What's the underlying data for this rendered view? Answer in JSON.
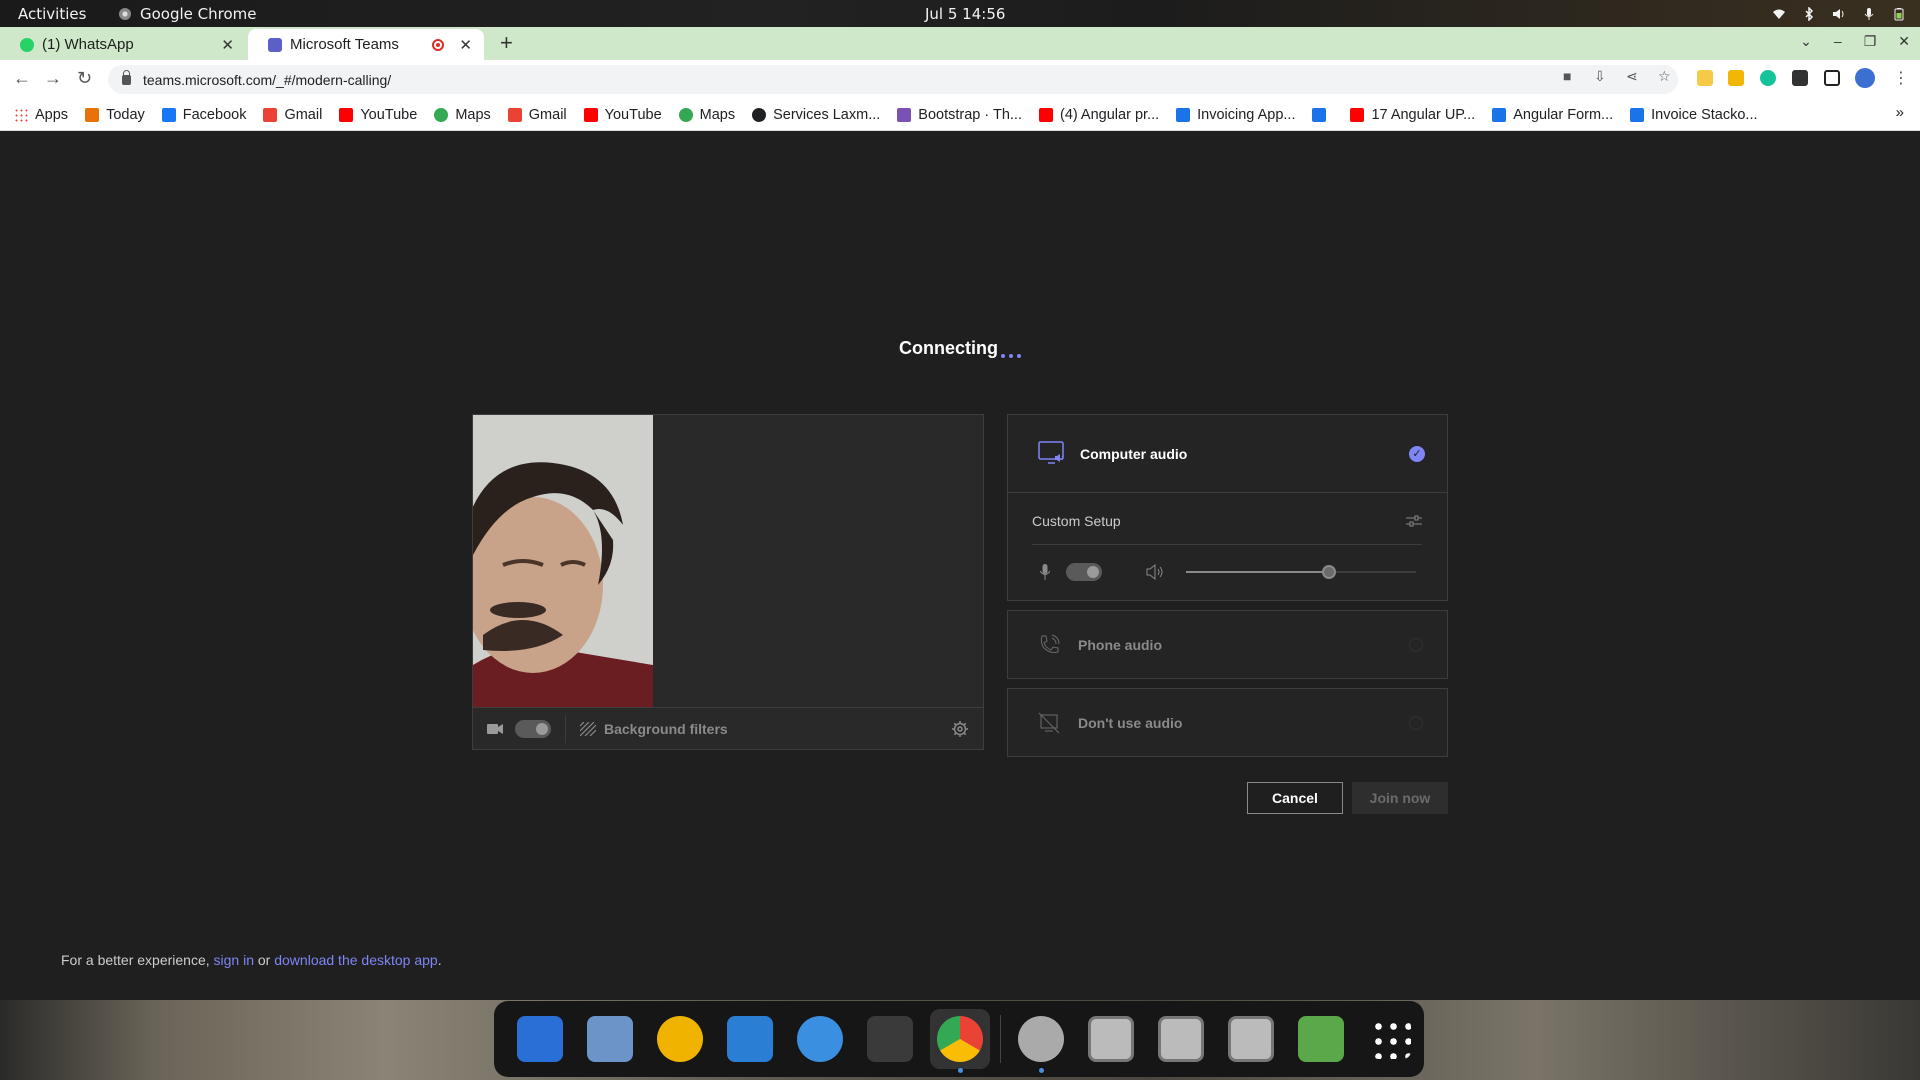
{
  "system": {
    "activities": "Activities",
    "app_name": "Google Chrome",
    "clock": "Jul 5  14:56"
  },
  "tabs": [
    {
      "label": "(1) WhatsApp",
      "favicon_color": "#25d366"
    },
    {
      "label": "Microsoft Teams",
      "favicon_color": "#5b5fc7",
      "recording": true
    }
  ],
  "address": {
    "url": "teams.microsoft.com/_#/modern-calling/"
  },
  "bookmarks": [
    {
      "label": "Apps",
      "icon": "apps-grid-icon",
      "color": "#4285f4"
    },
    {
      "label": "Today",
      "icon": "today-icon",
      "color": "#e8710a"
    },
    {
      "label": "Facebook",
      "icon": "facebook-icon",
      "color": "#1877f2"
    },
    {
      "label": "Gmail",
      "icon": "gmail-icon",
      "color": "#ea4335"
    },
    {
      "label": "YouTube",
      "icon": "youtube-icon",
      "color": "#ff0000"
    },
    {
      "label": "Maps",
      "icon": "maps-icon",
      "color": "#34a853"
    },
    {
      "label": "Gmail",
      "icon": "gmail-icon",
      "color": "#ea4335"
    },
    {
      "label": "YouTube",
      "icon": "youtube-icon",
      "color": "#ff0000"
    },
    {
      "label": "Maps",
      "icon": "maps-icon",
      "color": "#34a853"
    },
    {
      "label": "Services Laxm...",
      "icon": "globe-icon",
      "color": "#202124"
    },
    {
      "label": "Bootstrap · Th...",
      "icon": "bootstrap-icon",
      "color": "#7952b3"
    },
    {
      "label": "(4) Angular pr...",
      "icon": "youtube-icon",
      "color": "#ff0000"
    },
    {
      "label": "Invoicing App...",
      "icon": "bolt-icon",
      "color": "#1a73e8"
    },
    {
      "label": "",
      "icon": "bolt-icon",
      "color": "#1a73e8"
    },
    {
      "label": "17 Angular UP...",
      "icon": "youtube-icon",
      "color": "#ff0000"
    },
    {
      "label": "Angular Form...",
      "icon": "bolt-icon",
      "color": "#1a73e8"
    },
    {
      "label": "Invoice Stacko...",
      "icon": "bolt-icon",
      "color": "#1a73e8"
    }
  ],
  "bookmarks_overflow": "»",
  "teams": {
    "status": "Connecting",
    "video": {
      "background_filters": "Background filters"
    },
    "audio": {
      "computer_audio": "Computer audio",
      "custom_setup": "Custom Setup",
      "speaker_volume": 0.62,
      "phone_audio": "Phone audio",
      "dont_use_audio": "Don't use audio"
    },
    "buttons": {
      "cancel": "Cancel",
      "join": "Join now"
    },
    "footer": {
      "prefix": "For a better experience, ",
      "sign_in": "sign in",
      "or": " or ",
      "download": "download the desktop app",
      "suffix": "."
    },
    "accent_color": "#7f85f5"
  },
  "dock": [
    {
      "name": "thunderbird-icon",
      "color": "#2a6fd6"
    },
    {
      "name": "files-icon",
      "color": "#6d94c8"
    },
    {
      "name": "rhythmbox-icon",
      "color": "#f0b400"
    },
    {
      "name": "writer-icon",
      "color": "#2a7fd4"
    },
    {
      "name": "help-icon",
      "color": "#3a8fe0"
    },
    {
      "name": "terminal-icon",
      "color": "#3a3a3a"
    },
    {
      "name": "chrome-icon",
      "color": "#4285f4",
      "active": true
    },
    {
      "name": "settings-icon",
      "color": "#aaaaaa",
      "running": true
    },
    {
      "name": "disc-icon",
      "color": "#9a9a9a"
    },
    {
      "name": "disc-icon",
      "color": "#9a9a9a"
    },
    {
      "name": "disc-icon",
      "color": "#9a9a9a"
    },
    {
      "name": "trash-icon",
      "color": "#5aa84a"
    },
    {
      "name": "show-apps-icon",
      "color": "#ffffff"
    }
  ]
}
